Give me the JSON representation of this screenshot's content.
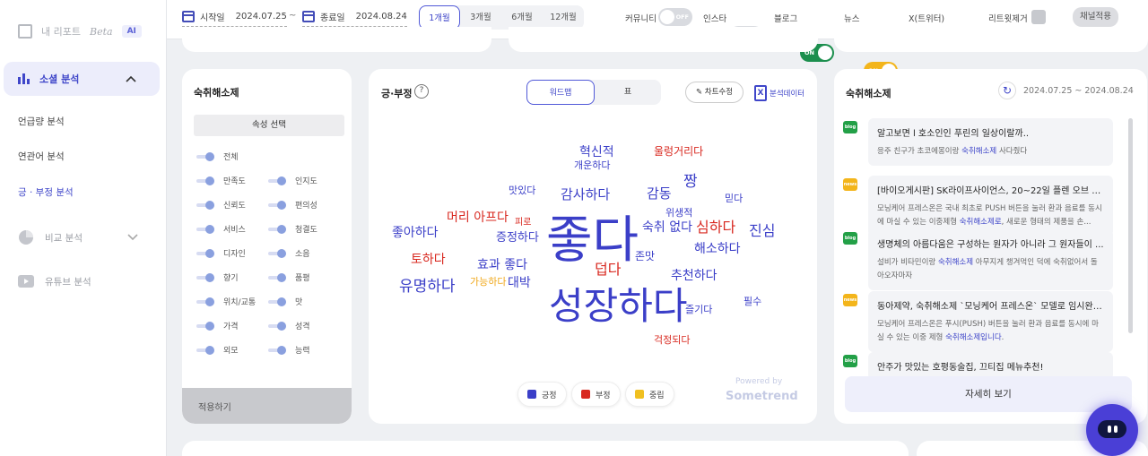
{
  "sidebar": {
    "logo_text": "내 리포트",
    "logo_beta": "Beta",
    "logo_ai": "AI",
    "active": "소셜 분석",
    "subs": [
      "언급량 분석",
      "연관어 분석",
      "긍 · 부정 분석"
    ],
    "compare": "비교 분석",
    "youtube": "유튜브 분석"
  },
  "topbar": {
    "start_label": "시작일",
    "start_date": "2024.07.25",
    "sep": "~",
    "end_label": "종료일",
    "end_date": "2024.08.24",
    "periods": [
      "1개월",
      "3개월",
      "6개월",
      "12개월"
    ],
    "channels": [
      {
        "label": "커뮤니티",
        "state": "OFF"
      },
      {
        "label": "인스타",
        "state": "OFF"
      },
      {
        "label": "블로그",
        "state": "ON",
        "color": "#1c8f4e"
      },
      {
        "label": "뉴스",
        "state": "ON",
        "color": "#f3b51b"
      },
      {
        "label": "X(트위터)",
        "state": "OFF"
      }
    ],
    "retweet": "리트윗제거",
    "apply": "채널적용"
  },
  "filter": {
    "title": "숙취해소제",
    "select": "속성 선택",
    "all": "전체",
    "left": [
      "만족도",
      "신뢰도",
      "서비스",
      "디자인",
      "향기",
      "위치/교통",
      "가격",
      "외모"
    ],
    "right": [
      "인지도",
      "편의성",
      "청결도",
      "소음",
      "품평",
      "맛",
      "성격",
      "능력"
    ],
    "apply": "적용하기"
  },
  "cloud": {
    "title": "긍·부정",
    "help": "?",
    "tabs": [
      "워드맵",
      "표"
    ],
    "edit": "차트수정",
    "xl_icon": "X",
    "export": "분석데이터",
    "legend": [
      "긍정",
      "부정",
      "중립"
    ],
    "powered1": "Powered by",
    "powered2": "Sometrend",
    "colors": {
      "pos": "#3b3fc8",
      "neg": "#d8281f",
      "neu": "#f0a81c"
    }
  },
  "chart_data": {
    "type": "wordcloud",
    "words": [
      {
        "t": "좋다",
        "s": "pos",
        "f": 56
      },
      {
        "t": "성장하다",
        "s": "pos",
        "f": 42
      },
      {
        "t": "혁신적",
        "s": "pos",
        "f": 14
      },
      {
        "t": "울렁거리다",
        "s": "neg",
        "f": 12
      },
      {
        "t": "개운하다",
        "s": "pos",
        "f": 11
      },
      {
        "t": "짱",
        "s": "pos",
        "f": 17
      },
      {
        "t": "맛있다",
        "s": "pos",
        "f": 11
      },
      {
        "t": "감사하다",
        "s": "pos",
        "f": 15
      },
      {
        "t": "감동",
        "s": "pos",
        "f": 15
      },
      {
        "t": "믿다",
        "s": "pos",
        "f": 11
      },
      {
        "t": "위생적",
        "s": "pos",
        "f": 11
      },
      {
        "t": "머리 아프다",
        "s": "neg",
        "f": 14
      },
      {
        "t": "피로",
        "s": "neg",
        "f": 10
      },
      {
        "t": "숙취 없다",
        "s": "pos",
        "f": 14
      },
      {
        "t": "심하다",
        "s": "neg",
        "f": 16
      },
      {
        "t": "진심",
        "s": "pos",
        "f": 16
      },
      {
        "t": "좋아하다",
        "s": "pos",
        "f": 14
      },
      {
        "t": "증정하다",
        "s": "pos",
        "f": 13
      },
      {
        "t": "해소하다",
        "s": "pos",
        "f": 14
      },
      {
        "t": "토하다",
        "s": "neg",
        "f": 14
      },
      {
        "t": "효과 좋다",
        "s": "pos",
        "f": 14
      },
      {
        "t": "존맛",
        "s": "pos",
        "f": 12
      },
      {
        "t": "덥다",
        "s": "neg",
        "f": 16
      },
      {
        "t": "추천하다",
        "s": "pos",
        "f": 14
      },
      {
        "t": "유명하다",
        "s": "pos",
        "f": 17
      },
      {
        "t": "가능하다",
        "s": "neu",
        "f": 11
      },
      {
        "t": "대박",
        "s": "pos",
        "f": 14
      },
      {
        "t": "필수",
        "s": "pos",
        "f": 11
      },
      {
        "t": "즐기다",
        "s": "pos",
        "f": 11
      },
      {
        "t": "걱정되다",
        "s": "neg",
        "f": 11
      }
    ]
  },
  "news": {
    "title": "숙취해소제",
    "range": "2024.07.25 ~ 2024.08.24",
    "items": [
      {
        "type": "blog",
        "t": "알고보면 l 호소인인 푸린의 일상이랄까..",
        "s1": "응주 친구가 초코에몽이랑 ",
        "h": "숙취해소제",
        "s2": " 사다줬다"
      },
      {
        "type": "news",
        "t": "[바이오게시판] SK라이프사이언스, 20~22일 플렌 오브 액...",
        "s1": "모닝케어 프레스온은 국내 최초로 PUSH 버튼을 눌러 환과 음료를 동시에 마실 수 있는 이중제형 ",
        "h": "숙취해소제로",
        "s2": ", 새로운 형태의 제품을 손..."
      },
      {
        "type": "blog",
        "t": "생명체의 아름다움은 구성하는 원자가 아니라 그 원자들이 ...",
        "s1": "설비가 비타민이랑 ",
        "h": "숙취해소제",
        "s2": " 아무지게 챙겨먹인 덕에 숙취없어서 돌아오자마자"
      },
      {
        "type": "news",
        "t": "동아제약, 숙취해소제 `모닝케어 프레스온` 모델로 임시완 ...",
        "s1": "모닝케어 프레스온은 푸시(PUSH) 버튼을 눌러 환과 음료를 동시에 마실 수 있는 이중 제형 ",
        "h": "숙취해소제입니다",
        "s2": "."
      },
      {
        "type": "blog",
        "t": "안주가 맛있는 호평동술집, 끄티집 메뉴추천!",
        "s1": "",
        "h": "",
        "s2": ""
      }
    ],
    "more": "자세히 보기",
    "icons": {
      "blog": "blog",
      "news": "news"
    }
  }
}
